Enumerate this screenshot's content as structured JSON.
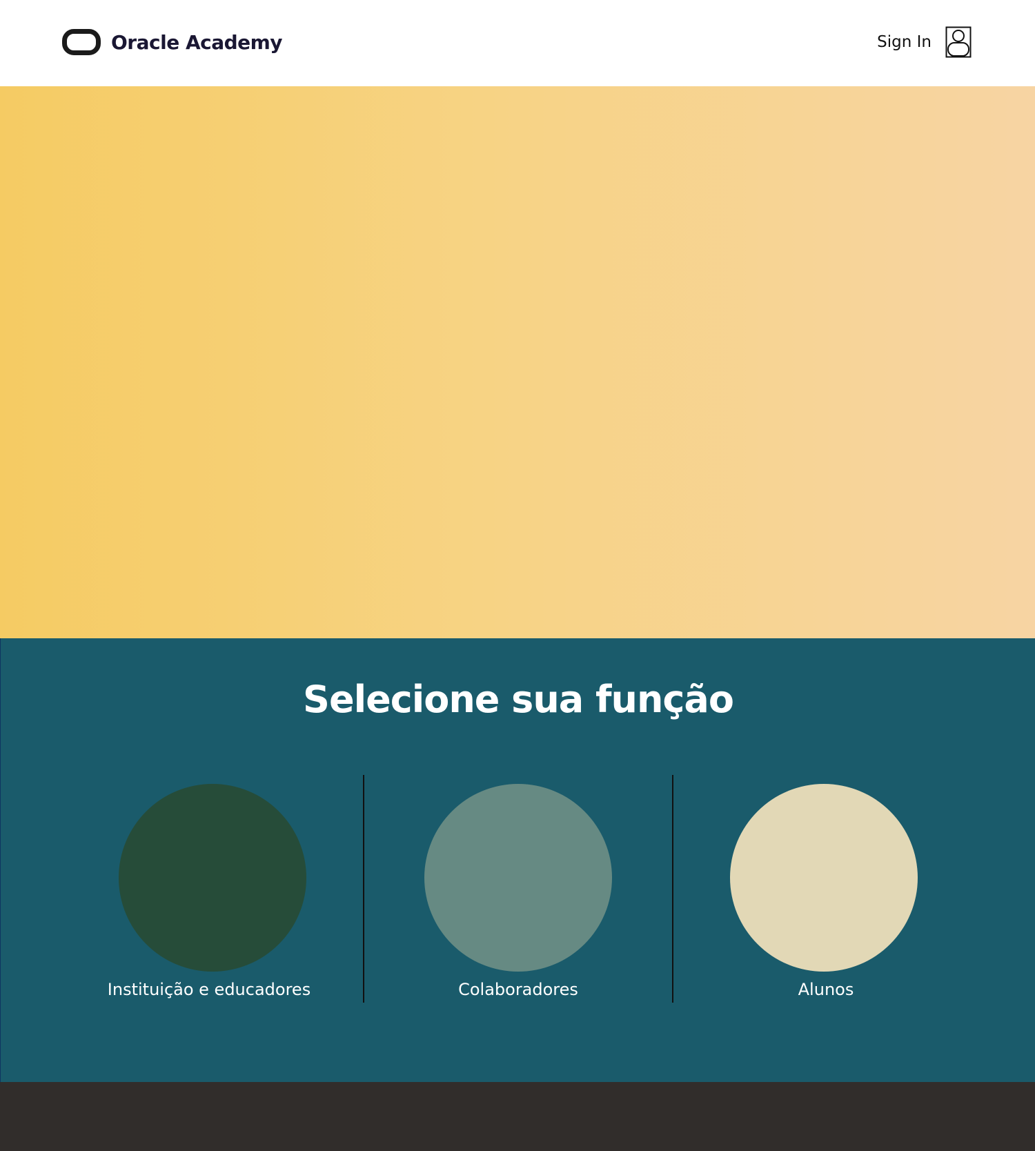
{
  "header": {
    "brand": "Oracle Academy",
    "sign_in_label": "Sign In",
    "logo_icon": "oracle-logo-icon",
    "user_icon": "user-icon"
  },
  "hero": {
    "gradient": [
      "#f5cb63",
      "#f7d383",
      "#f7d4a3"
    ]
  },
  "roles": {
    "title": "Selecione sua função",
    "background": "#1a5b6b",
    "items": [
      {
        "label": "Instituição e educadores",
        "color": "#264c39"
      },
      {
        "label": "Colaboradores",
        "color": "#668a83"
      },
      {
        "label": "Alunos",
        "color": "#e2d8b6"
      }
    ]
  },
  "footer": {
    "background": "#312d2b"
  }
}
